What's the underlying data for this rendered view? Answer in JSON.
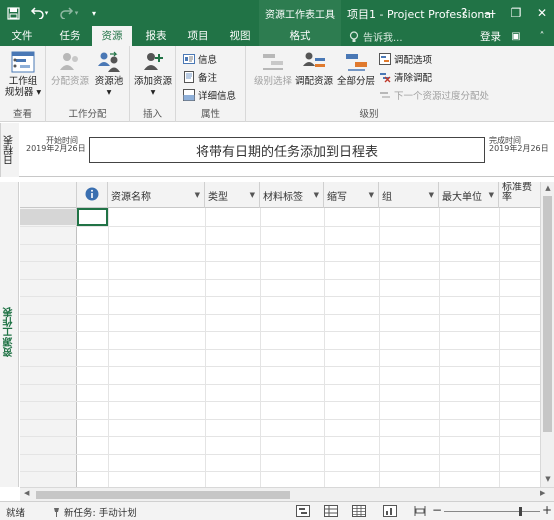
{
  "titlebar": {
    "save_icon": "save-icon",
    "undo_icon": "undo-icon",
    "redo_icon": "redo-icon",
    "customize_icon": "customize-qat-icon",
    "context_tool": "资源工作表工具",
    "app_title": "项目1 - Project Professional",
    "window_buttons": [
      "?",
      "—",
      "❐",
      "✕"
    ]
  },
  "tabs": {
    "file": "文件",
    "task": "任务",
    "resource": "资源",
    "report": "报表",
    "project": "项目",
    "view": "视图",
    "format": "格式",
    "tell_me": "告诉我...",
    "login": "登录"
  },
  "ribbon": {
    "view_group": {
      "label": "查看",
      "team_planner": "工作组\n规划器 ▾"
    },
    "assign_group": {
      "label": "工作分配",
      "assign_resources": "分配资源",
      "resource_pool": "资源池\n▾"
    },
    "insert_group": {
      "label": "插入",
      "add_resources": "添加资源\n▾"
    },
    "properties_group": {
      "label": "属性",
      "info": "信息",
      "notes": "备注",
      "details": "详细信息"
    },
    "level_group": {
      "label": "级别",
      "level_selection": "级别选择",
      "level_resource": "调配资源",
      "level_all": "全部分层",
      "leveling_options": "调配选项",
      "clear_leveling": "清除调配",
      "next_overallocation": "下一个资源过度分配处"
    }
  },
  "timeline": {
    "tab_label": "日程表",
    "start_label": "开始时间",
    "start_date": "2019年2月26日",
    "bar_text": "将带有日期的任务添加到日程表",
    "end_label": "完成时间",
    "end_date": "2019年2月26日"
  },
  "sheet": {
    "side_label": "资源工作表",
    "columns": [
      {
        "label": "资源名称"
      },
      {
        "label": "类型"
      },
      {
        "label": "材料标签"
      },
      {
        "label": "缩写"
      },
      {
        "label": "组"
      },
      {
        "label": "最大单位"
      },
      {
        "label": "标准费率"
      }
    ]
  },
  "statusbar": {
    "ready": "就绪",
    "new_task": "新任务: 手动计划",
    "zoom_minus": "−",
    "zoom_plus": "+"
  },
  "colors": {
    "brand": "#217346",
    "ribbon_bg": "#f3f3f3"
  }
}
